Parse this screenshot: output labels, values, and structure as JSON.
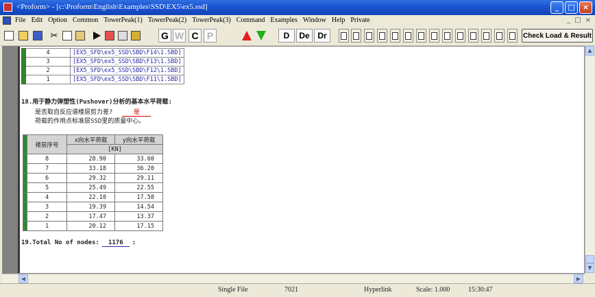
{
  "window": {
    "title": "<Proform> - [c:\\Proform\\English\\Examples\\SSD\\EX5\\ex5.ssd]"
  },
  "menubar": {
    "items": [
      "File",
      "Edit",
      "Option",
      "Common",
      "TowerPeak(1)",
      "TowerPeak(2)",
      "TowerPeak(3)",
      "Command",
      "Examples",
      "Window",
      "Help",
      "Private"
    ],
    "mdi_controls": [
      "_",
      "□",
      "×"
    ]
  },
  "toolbar": {
    "letters": [
      "G",
      "W",
      "C",
      "P"
    ],
    "words": [
      "D",
      "De",
      "Dr"
    ],
    "check_label": "Check Load & Result"
  },
  "content": {
    "file_table": [
      {
        "num": "4",
        "path": "[EX5_SFD\\ex5_SSD\\SBD\\F14\\1.SBD]"
      },
      {
        "num": "3",
        "path": "[EX5_SFD\\ex5_SSD\\SBD\\F13\\1.SBD]"
      },
      {
        "num": "2",
        "path": "[EX5_SFD\\ex5_SSD\\SBD\\F12\\1.SBD]"
      },
      {
        "num": "1",
        "path": "[EX5_SFD\\ex5_SSD\\SBD\\F11\\1.SBD]"
      }
    ],
    "section18": {
      "title": "18.用于静力弹塑性(Pushover)分析的基本水平荷载:",
      "question1": "是否取自反应谱楼层剪力差?",
      "answer1": "是",
      "question2": "荷载的作用点标准层SSD里的质量中心。"
    },
    "load_table": {
      "headers": [
        "楼层序号",
        "x向水平荷载",
        "y向水平荷载"
      ],
      "unit": "[KN]",
      "rows": [
        {
          "floor": "8",
          "x": "28.90",
          "y": "33.60"
        },
        {
          "floor": "7",
          "x": "33.18",
          "y": "36.20"
        },
        {
          "floor": "6",
          "x": "29.32",
          "y": "29.11"
        },
        {
          "floor": "5",
          "x": "25.49",
          "y": "22.55"
        },
        {
          "floor": "4",
          "x": "22.10",
          "y": "17.58"
        },
        {
          "floor": "3",
          "x": "19.39",
          "y": "14.54"
        },
        {
          "floor": "2",
          "x": "17.47",
          "y": "13.37"
        },
        {
          "floor": "1",
          "x": "20.12",
          "y": "17.15"
        }
      ]
    },
    "section19": {
      "label": "19.Total No of nodes:",
      "value": "1176",
      "suffix": ":"
    }
  },
  "statusbar": {
    "mode": "Single File",
    "code": "7021",
    "hyperlink": "Hyperlink",
    "scale": "Scale: 1.000",
    "time": "15:30:47"
  }
}
